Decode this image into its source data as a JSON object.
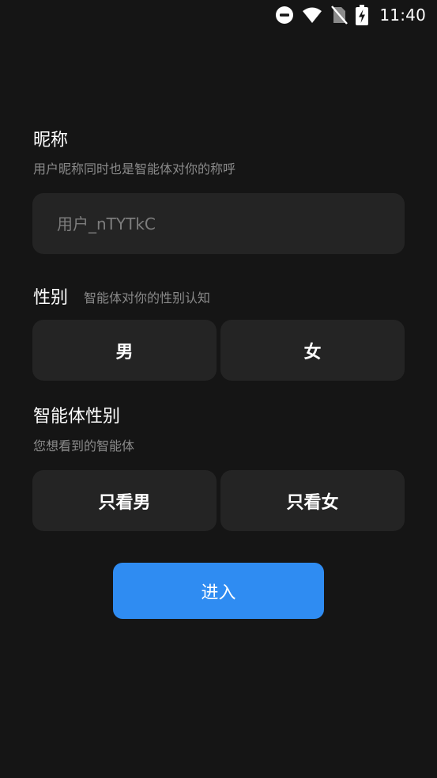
{
  "status_bar": {
    "time": "11:40",
    "icons": [
      "do-not-disturb-icon",
      "wifi-icon",
      "no-sim-icon",
      "battery-charging-icon"
    ]
  },
  "nickname": {
    "title": "昵称",
    "subtitle": "用户昵称同时也是智能体对你的称呼",
    "placeholder": "用户_nTYTkC"
  },
  "gender": {
    "title": "性别",
    "subtitle": "智能体对你的性别认知",
    "options": [
      "男",
      "女"
    ]
  },
  "agent_gender": {
    "title": "智能体性别",
    "subtitle": "您想看到的智能体",
    "options": [
      "只看男",
      "只看女"
    ]
  },
  "enter_button": {
    "label": "进入",
    "color": "#2f8cf2"
  },
  "colors": {
    "background": "#151515",
    "field": "#242424",
    "secondary_text": "#8a8a8a"
  }
}
